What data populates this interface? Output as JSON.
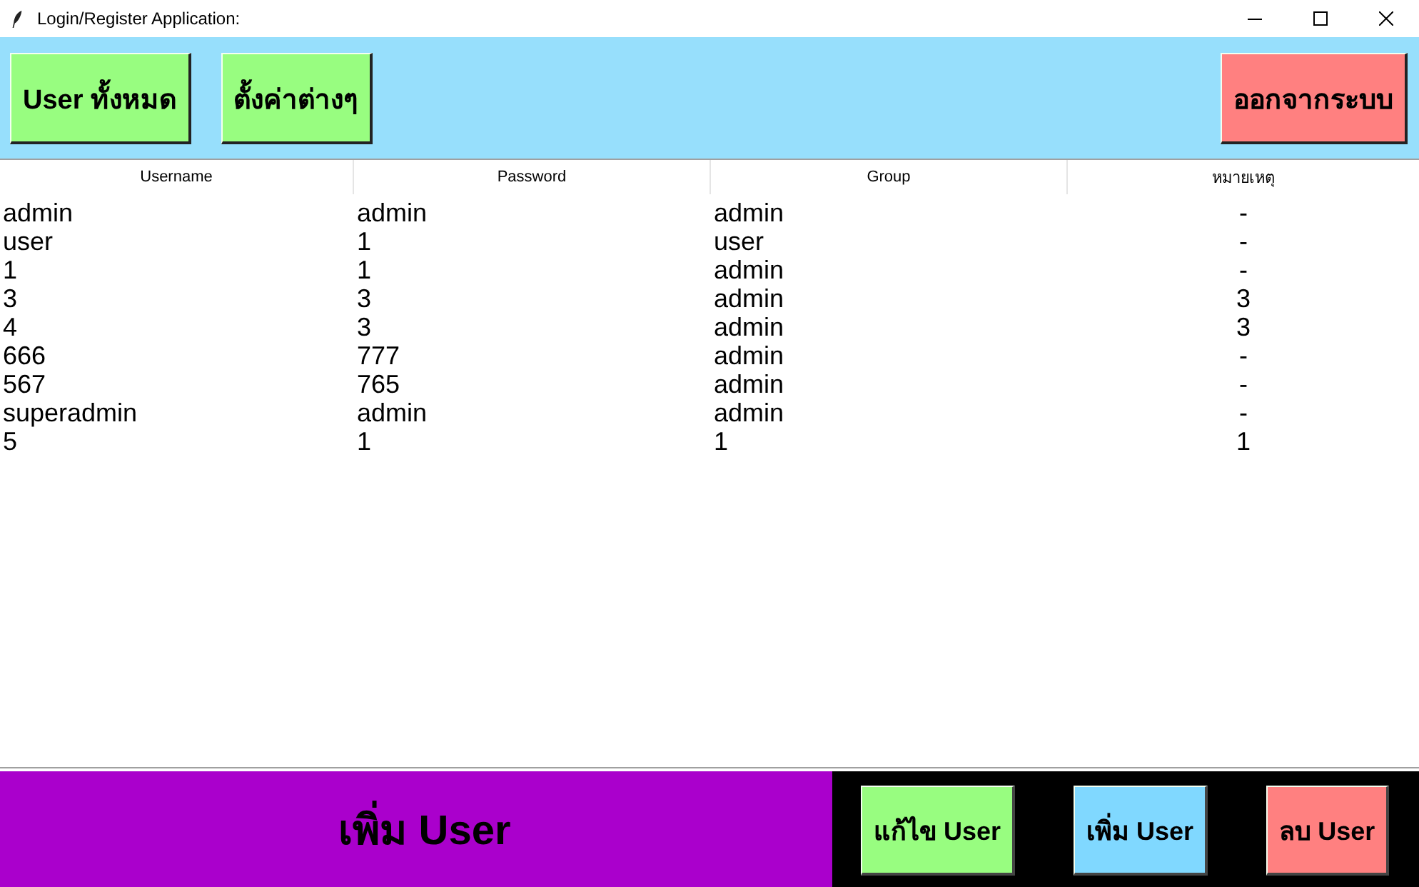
{
  "window": {
    "title": "Login/Register Application:"
  },
  "toolbar": {
    "left_buttons": [
      {
        "label": "User ทั้งหมด",
        "color": "#98fd80"
      },
      {
        "label": "ตั้งค่าต่างๆ",
        "color": "#98fd80"
      }
    ],
    "right_buttons": [
      {
        "label": "ออกจากระบบ",
        "color": "#ff8080"
      }
    ]
  },
  "table": {
    "columns": [
      "Username",
      "Password",
      "Group",
      "หมายเหตุ"
    ],
    "rows": [
      [
        "admin",
        "admin",
        "admin",
        "-"
      ],
      [
        "user",
        "1",
        "user",
        "-"
      ],
      [
        "1",
        "1",
        "admin",
        "-"
      ],
      [
        "3",
        "3",
        "admin",
        "3"
      ],
      [
        "4",
        "3",
        "admin",
        "3"
      ],
      [
        "666",
        "777",
        "admin",
        "-"
      ],
      [
        "567",
        "765",
        "admin",
        "-"
      ],
      [
        "superadmin",
        "admin",
        "admin",
        "-"
      ],
      [
        "5",
        "1",
        "1",
        "1"
      ]
    ]
  },
  "bottom_bar": {
    "title": "เพิ่ม User",
    "buttons": [
      {
        "label": "แก้ไข User",
        "color": "#98fd80"
      },
      {
        "label": "เพิ่ม User",
        "color": "#80d8ff"
      },
      {
        "label": "ลบ User",
        "color": "#ff8080"
      }
    ]
  }
}
